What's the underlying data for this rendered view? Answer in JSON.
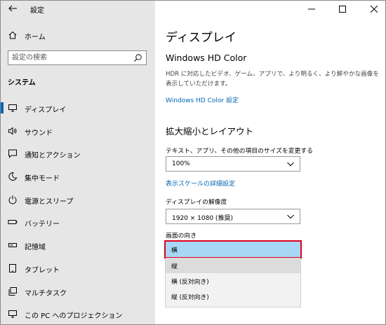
{
  "window": {
    "app_title": "設定"
  },
  "sidebar": {
    "home_label": "ホーム",
    "search_placeholder": "設定の検索",
    "section_header": "システム",
    "items": [
      {
        "label": "ディスプレイ",
        "icon": "display-icon",
        "active": true
      },
      {
        "label": "サウンド",
        "icon": "speaker-icon"
      },
      {
        "label": "通知とアクション",
        "icon": "notification-icon"
      },
      {
        "label": "集中モード",
        "icon": "moon-icon"
      },
      {
        "label": "電源とスリープ",
        "icon": "power-icon"
      },
      {
        "label": "バッテリー",
        "icon": "battery-icon"
      },
      {
        "label": "記憶域",
        "icon": "storage-icon"
      },
      {
        "label": "タブレット",
        "icon": "tablet-icon"
      },
      {
        "label": "マルチタスク",
        "icon": "multitask-icon"
      },
      {
        "label": "この PC へのプロジェクション",
        "icon": "projection-icon"
      }
    ]
  },
  "main": {
    "title": "ディスプレイ",
    "hdr_heading": "Windows HD Color",
    "hdr_desc": "HDR に対応したビデオ、ゲーム、アプリで、より明るく、より鮮やかな画像を表示していただけます。",
    "hdr_link": "Windows HD Color 設定",
    "scale_heading": "拡大縮小とレイアウト",
    "scale_label": "テキスト、アプリ、その他の項目のサイズを変更する",
    "scale_value": "100%",
    "advanced_scale_link": "表示スケールの詳細設定",
    "resolution_label": "ディスプレイの解像度",
    "resolution_value": "1920 × 1080 (推奨)",
    "orientation_label": "画面の向き",
    "orientation_options": [
      "横",
      "縦",
      "横 (反対向き)",
      "縦 (反対向き)"
    ],
    "orientation_selected": "横"
  },
  "colors": {
    "accent": "#0063b1",
    "link": "#0067b8",
    "selection": "#a8d7f5",
    "highlight_border": "#e0001a"
  }
}
